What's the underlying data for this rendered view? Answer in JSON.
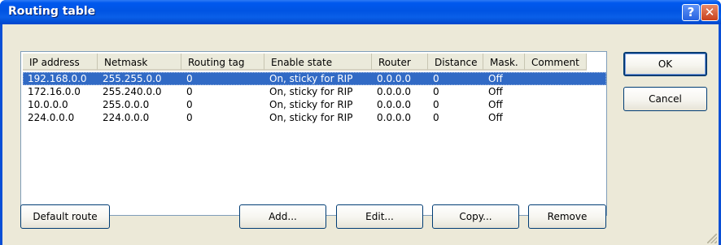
{
  "window": {
    "title": "Routing table"
  },
  "titlebar": {
    "help_label": "?",
    "close_label": "✕"
  },
  "table": {
    "columns": [
      "IP address",
      "Netmask",
      "Routing tag",
      "Enable state",
      "Router",
      "Distance",
      "Mask.",
      "Comment"
    ],
    "rows": [
      [
        "192.168.0.0",
        "255.255.0.0",
        "0",
        "On, sticky for RIP",
        "0.0.0.0",
        "0",
        "Off",
        ""
      ],
      [
        "172.16.0.0",
        "255.240.0.0",
        "0",
        "On, sticky for RIP",
        "0.0.0.0",
        "0",
        "Off",
        ""
      ],
      [
        "10.0.0.0",
        "255.0.0.0",
        "0",
        "On, sticky for RIP",
        "0.0.0.0",
        "0",
        "Off",
        ""
      ],
      [
        "224.0.0.0",
        "224.0.0.0",
        "0",
        "On, sticky for RIP",
        "0.0.0.0",
        "0",
        "Off",
        ""
      ]
    ],
    "selected_row": 0
  },
  "buttons": {
    "ok": "OK",
    "cancel": "Cancel",
    "default_route": "Default route",
    "add": "Add...",
    "edit": "Edit...",
    "copy": "Copy...",
    "remove": "Remove"
  }
}
